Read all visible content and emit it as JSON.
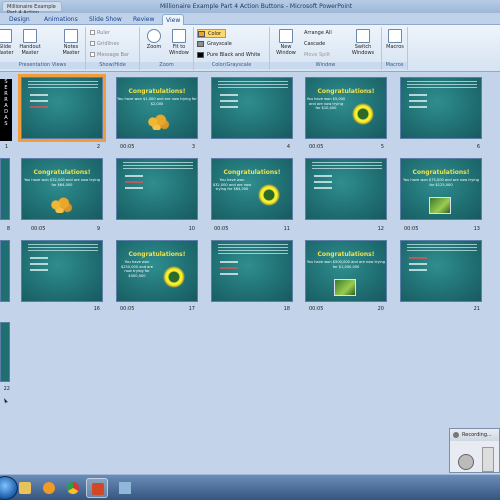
{
  "window": {
    "title": "Millionaire Example Part 4 Action Buttons - Microsoft PowerPoint",
    "tab_left": "Millionaire Example Part 4 Action Buttons..."
  },
  "ribbon_tabs": [
    "Design",
    "Animations",
    "Slide Show",
    "Review",
    "View"
  ],
  "ribbon": {
    "presentation_views": {
      "label": "Presentation Views",
      "buttons": [
        "Slide Master",
        "Handout Master",
        "Notes Master"
      ]
    },
    "show_hide": {
      "label": "Show/Hide",
      "items": [
        "Ruler",
        "Gridlines",
        "Message Bar"
      ]
    },
    "zoom": {
      "label": "Zoom",
      "buttons": [
        "Zoom",
        "Fit to Window"
      ]
    },
    "color_grayscale": {
      "label": "Color/Grayscale",
      "items": [
        "Color",
        "Grayscale",
        "Pure Black and White"
      ],
      "selected": "Color",
      "swatches": [
        "#e9a62a",
        "#8f8f8f",
        "#000000"
      ]
    },
    "window": {
      "label": "Window",
      "new_window": "New Window",
      "items": [
        "Arrange All",
        "Cascade",
        "Move Split"
      ],
      "switch_windows": "Switch Windows"
    },
    "macros": {
      "label": "Macros",
      "button": "Macros"
    }
  },
  "slides": {
    "congrats": "Congratulations!",
    "sub_texts": {
      "s3": "You have won $1,000 and are now trying for $2,000",
      "s5": "You have won $5,000 and are now trying for $10,000",
      "s9": "You have won $32,000 and are now trying for $64,000",
      "s11": "You have won $32,000 and are now trying for $64,000",
      "s13": "You have won $75,000 and are now trying for $125,000",
      "s16": "You have won $250,000 and are now trying for $500,000",
      "s19": "You have won $500,000 and are now trying for $1,000,000"
    },
    "numbers": [
      "1",
      "2",
      "3",
      "4",
      "5",
      "6",
      "8",
      "9",
      "10",
      "11",
      "12",
      "13",
      "15",
      "16",
      "17",
      "18",
      "19",
      "20",
      "21",
      "22"
    ],
    "timing": "00:05",
    "vertical_title": "S E R R A D A S"
  },
  "recording": {
    "title": "Recording..."
  },
  "colors": {
    "slide_bg": "#1f6e72",
    "selected_outline": "#f39c3c",
    "congrats_yellow": "#f3e24a"
  }
}
